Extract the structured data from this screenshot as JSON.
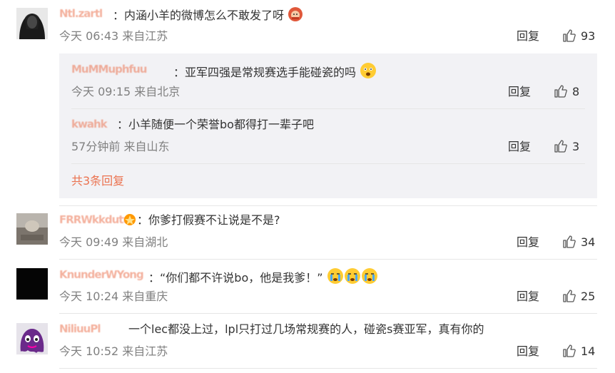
{
  "comments": [
    {
      "username": "Ntl.zartl",
      "text": "：内涵小羊的微博怎么不敢发了呀",
      "emoji": "doll-emoji",
      "time": "今天 06:43 来自江苏",
      "reply_label": "回复",
      "likes": "93"
    },
    {
      "username": "FRRWkkdutu",
      "text": "：你爹打假赛不让说是不是?",
      "time": "今天 09:49 来自湖北",
      "reply_label": "回复",
      "likes": "34"
    },
    {
      "username": "KnunderWYong",
      "text": "：“你们都不许说bo，他是我爹！”",
      "emoji": "crying-emoji",
      "time": "今天 10:24 来自重庆",
      "reply_label": "回复",
      "likes": "25"
    },
    {
      "username": "NiliuuPl",
      "text": "一个lec都没上过，lpl只打过几场常规赛的人，碰瓷s赛亚军，真有你的",
      "time": "今天 10:52 来自江苏",
      "reply_label": "回复",
      "likes": "14"
    }
  ],
  "replies": [
    {
      "username": "MuMMuphfuu",
      "text": "：亚军四强是常规赛选手能碰瓷的吗",
      "emoji": "scared-emoji",
      "time": "今天 09:15 来自北京",
      "reply_label": "回复",
      "likes": "8"
    },
    {
      "username": "kwahk",
      "text": "：小羊随便一个荣誉bo都得打一辈子吧",
      "time": "57分钟前 来自山东",
      "reply_label": "回复",
      "likes": "3"
    }
  ],
  "more_replies": "共3条回复",
  "colors": {
    "accent": "#eb7350",
    "subbox_bg": "#f2f2f5",
    "meta": "#808080"
  }
}
